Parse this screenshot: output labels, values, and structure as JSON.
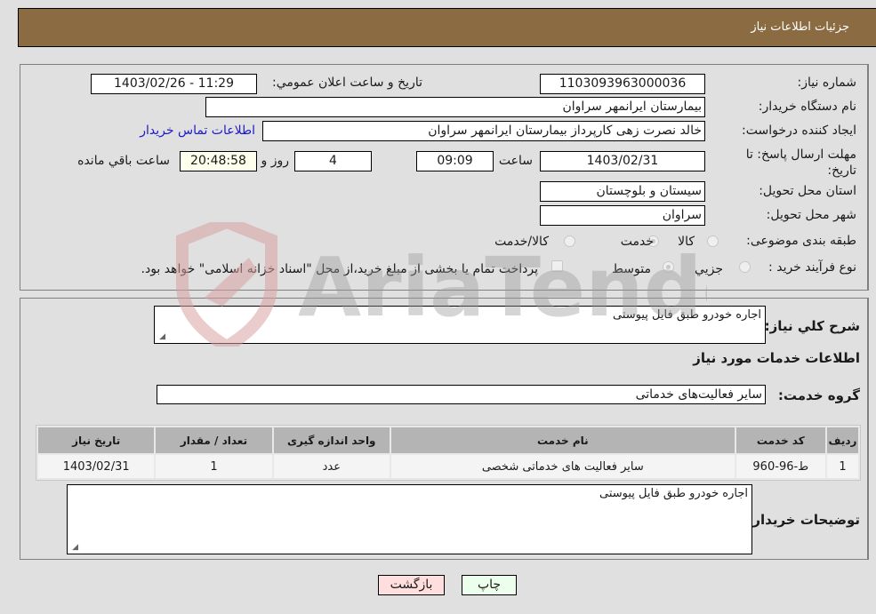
{
  "header": {
    "title": "جزئیات اطلاعات نیاز"
  },
  "form": {
    "need_number": {
      "label": "شماره نیاز:",
      "value": "1103093963000036"
    },
    "announce_datetime": {
      "label": "تاریخ و ساعت اعلان عمومي:",
      "value": "1403/02/26 - 11:29"
    },
    "buyer_org": {
      "label": "نام دستگاه خريدار:",
      "value": "بيمارستان ايرانمهر سراوان"
    },
    "requester": {
      "label": "ايجاد کننده درخواست:",
      "value": "خالد نصرت زهی کارپرداز بیمارستان ایرانمهر سراوان"
    },
    "buyer_contact_link": "اطلاعات تماس خريدار",
    "deadline": {
      "label": "مهلت ارسال پاسخ: تا تاریخ:",
      "date": "1403/02/31",
      "time_label": "ساعت",
      "time": "09:09",
      "days": "4",
      "days_label": "روز و",
      "remaining": "20:48:58",
      "remaining_label": "ساعت باقي مانده"
    },
    "province": {
      "label": "استان محل تحویل:",
      "value": "سيستان و بلوچستان"
    },
    "city": {
      "label": "شهر محل تحویل:",
      "value": "سراوان"
    },
    "category": {
      "label": "طبقه بندی موضوعی:",
      "options": [
        "کالا",
        "خدمت",
        "کالا/خدمت"
      ],
      "selected": "خدمت"
    },
    "purchase_type": {
      "label": "نوع فرآيند خريد :",
      "options": [
        "جزيي",
        "متوسط"
      ],
      "selected": "متوسط",
      "treasury_note": "پرداخت تمام یا بخشی از مبلغ خرید،از محل \"اسناد خزانه اسلامی\" خواهد بود."
    }
  },
  "details": {
    "general_desc_label": "شرح کلي نياز:",
    "general_desc": "اجاره خودرو طبق فایل پیوستی",
    "services_heading": "اطلاعات خدمات مورد نياز",
    "service_group_label": "گروه خدمت:",
    "service_group": "سایر فعالیت‌های خدماتی",
    "table": {
      "columns": [
        "رديف",
        "کد خدمت",
        "نام خدمت",
        "واحد اندازه گيری",
        "تعداد / مقدار",
        "تاريخ نياز"
      ],
      "rows": [
        [
          "1",
          "ط-96-960",
          "سایر فعالیت های خدماتی شخصی",
          "عدد",
          "1",
          "1403/02/31"
        ]
      ]
    },
    "buyer_notes_label": "توضيحات خريدار:",
    "buyer_notes": "اجاره خودرو طبق فایل پیوستی"
  },
  "buttons": {
    "print": "چاپ",
    "back": "بازگشت"
  },
  "watermark": {
    "text": "AriaTender.neT"
  },
  "colors": {
    "header_bg": "#8b6b41",
    "back_btn": "#ffdede",
    "print_btn": "#ecffec",
    "link": "#1a1acc",
    "remaining_bg": "#ffffee"
  }
}
